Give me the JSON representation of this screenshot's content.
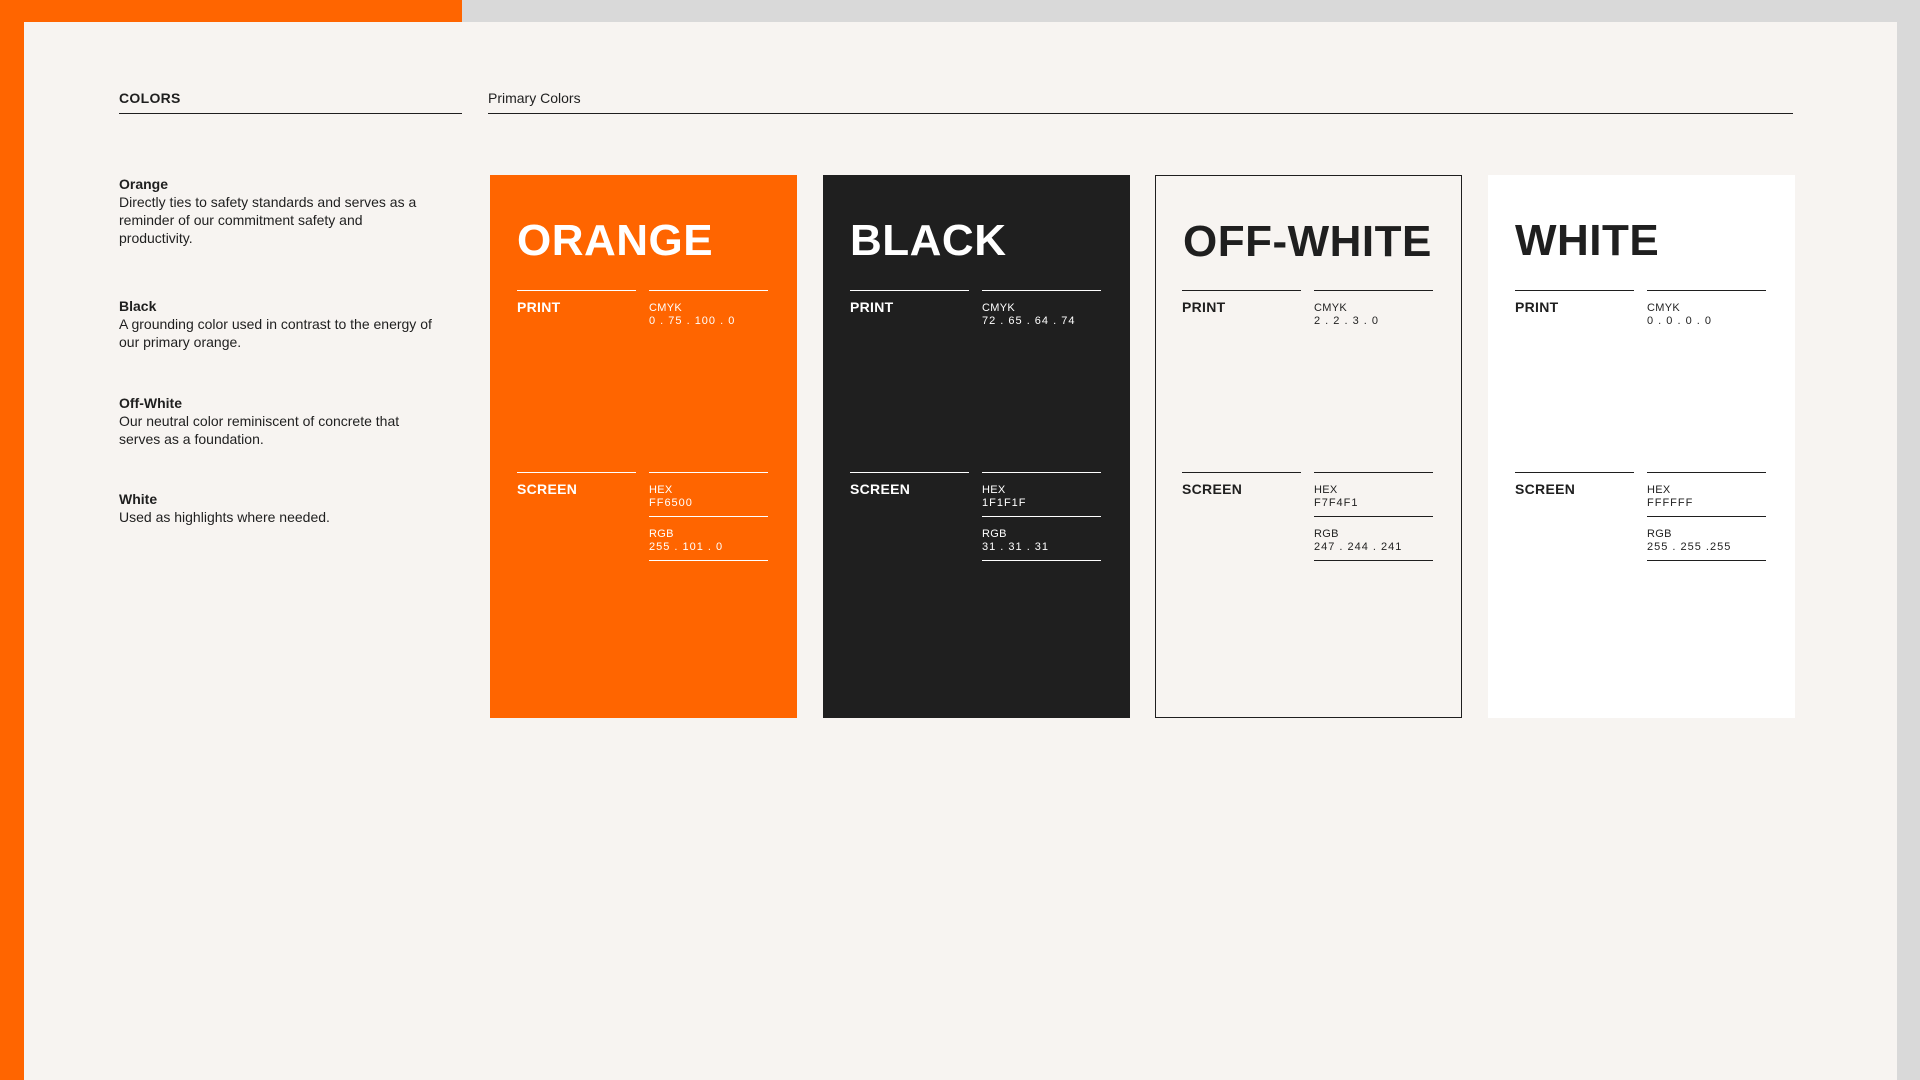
{
  "header": {
    "section": "COLORS",
    "subsection": "Primary Colors"
  },
  "descriptions": [
    {
      "name": "Orange",
      "text": "Directly ties to safety standards and serves as a reminder of our commitment safety and productivity."
    },
    {
      "name": "Black",
      "text": "A grounding color used in contrast to the energy of our primary orange."
    },
    {
      "name": "Off-White",
      "text": "Our neutral color reminiscent of concrete that serves as a foundation."
    },
    {
      "name": "White",
      "text": "Used as highlights where needed."
    }
  ],
  "labels": {
    "print": "PRINT",
    "screen": "SCREEN",
    "cmyk": "CMYK",
    "hex": "HEX",
    "rgb": "RGB"
  },
  "swatches": [
    {
      "name": "ORANGE",
      "cmyk": "0 . 75 . 100 . 0",
      "hex": "FF6500",
      "rgb": "255 . 101 . 0",
      "bg": "#FF6500",
      "fg": "#FFFFFF",
      "border": false
    },
    {
      "name": "BLACK",
      "cmyk": "72 . 65 . 64 . 74",
      "hex": "1F1F1F",
      "rgb": "31 . 31 . 31",
      "bg": "#1F1F1F",
      "fg": "#FFFFFF",
      "border": false
    },
    {
      "name": "OFF-WHITE",
      "cmyk": "2 . 2 . 3 . 0",
      "hex": "F7F4F1",
      "rgb": "247 . 244 . 241",
      "bg": "#F7F4F1",
      "fg": "#1F1F1F",
      "border": true
    },
    {
      "name": "WHITE",
      "cmyk": "0 . 0 . 0 . 0",
      "hex": "FFFFFF",
      "rgb": "255 . 255 .255",
      "bg": "#FFFFFF",
      "fg": "#1F1F1F",
      "border": false
    }
  ]
}
